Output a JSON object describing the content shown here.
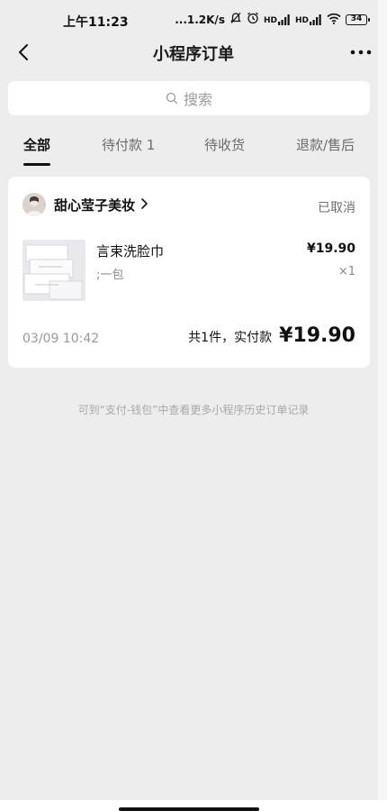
{
  "status_bar": {
    "time": "上午11:23",
    "network_speed": "...1.2K/s",
    "sim1_label": "HD",
    "sim2_label": "HD",
    "battery": "34"
  },
  "nav": {
    "title": "小程序订单",
    "back_icon": "chevron-left-icon",
    "more_icon": "more-dots-icon"
  },
  "search": {
    "placeholder": "搜索",
    "icon": "search-icon"
  },
  "tabs": [
    {
      "label": "全部",
      "active": true
    },
    {
      "label": "待付款 1",
      "active": false
    },
    {
      "label": "待收货",
      "active": false
    },
    {
      "label": "退款/售后",
      "active": false
    }
  ],
  "order": {
    "shop_name": "甜心莹子美妆",
    "status": "已取消",
    "product": {
      "name": "言束洗脸巾",
      "spec": ";一包",
      "price": "¥19.90",
      "qty": "×1"
    },
    "time": "03/09 10:42",
    "total_label": "共1件，实付款",
    "total_amount": "¥19.90"
  },
  "history_hint": "可到“支付-钱包”中查看更多小程序历史订单记录"
}
